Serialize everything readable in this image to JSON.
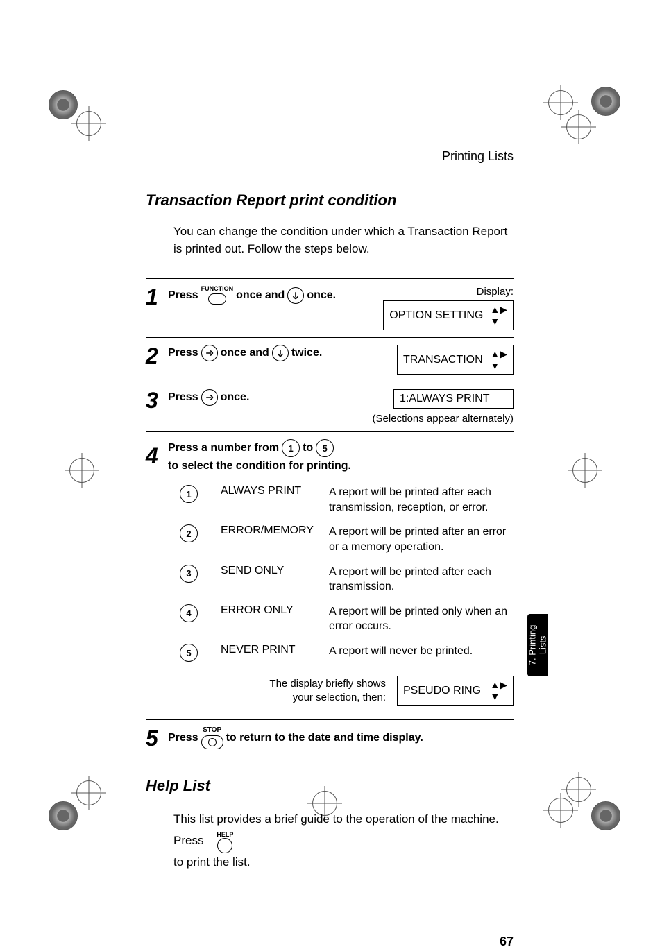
{
  "header": {
    "running": "Printing Lists"
  },
  "section1": {
    "title": "Transaction Report print condition",
    "intro": "You can change the condition under which a Transaction Report is printed out. Follow the steps below."
  },
  "steps": {
    "s1": {
      "num": "1",
      "press": "Press",
      "func": "FUNCTION",
      "mid": "once and",
      "end": "once.",
      "displayLabel": "Display:",
      "lcd": "OPTION SETTING"
    },
    "s2": {
      "num": "2",
      "press": "Press",
      "mid": "once and",
      "end": "twice.",
      "lcd": "TRANSACTION"
    },
    "s3": {
      "num": "3",
      "press": "Press",
      "end": "once.",
      "lcd": "1:ALWAYS PRINT",
      "note": "(Selections appear alternately)"
    },
    "s4": {
      "num": "4",
      "lead": "Press a number from",
      "to": "to",
      "tail": "to select the condition for printing.",
      "from": "1",
      "toNum": "5",
      "options": [
        {
          "n": "1",
          "label": "ALWAYS PRINT",
          "desc": "A report will be printed after each transmission, reception, or error."
        },
        {
          "n": "2",
          "label": "ERROR/MEMORY",
          "desc": "A report will be printed after an error or a memory operation."
        },
        {
          "n": "3",
          "label": "SEND ONLY",
          "desc": "A report will be printed after each transmission."
        },
        {
          "n": "4",
          "label": "ERROR ONLY",
          "desc": "A report will be printed only when an error occurs."
        },
        {
          "n": "5",
          "label": "NEVER PRINT",
          "desc": "A report will never be printed."
        }
      ],
      "afterTxt1": "The display briefly shows",
      "afterTxt2": "your selection, then:",
      "afterLcd": "PSEUDO RING"
    },
    "s5": {
      "num": "5",
      "press": "Press",
      "stop": "STOP",
      "end": "to return to the date and time display."
    }
  },
  "section2": {
    "title": "Help List",
    "body1": "This list provides a brief guide to the operation of the machine. Press",
    "body2": "to print the list.",
    "help": "HELP"
  },
  "tab": {
    "line1": "7. Printing",
    "line2": "Lists"
  },
  "pagenum": "67"
}
